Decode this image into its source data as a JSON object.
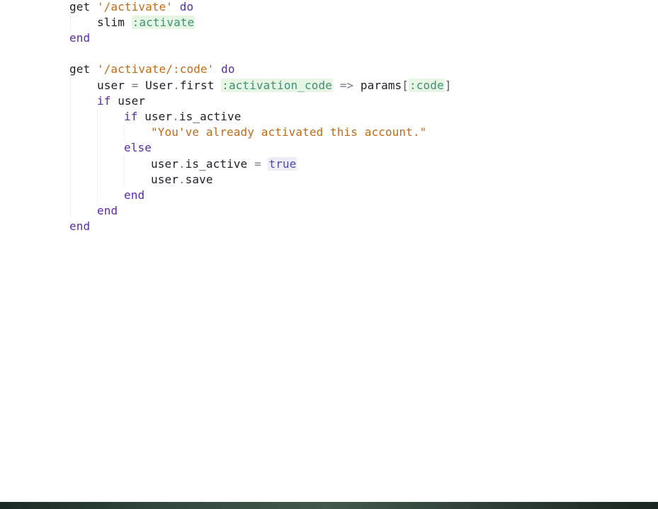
{
  "editor": {
    "lines": [
      [
        {
          "t": "get ",
          "c": "plain"
        },
        {
          "t": "'/activate'",
          "c": "str"
        },
        {
          "t": " ",
          "c": "plain"
        },
        {
          "t": "do",
          "c": "kw"
        }
      ],
      [
        {
          "t": "slim ",
          "c": "plain"
        },
        {
          "t": ":activate",
          "c": "sym"
        }
      ],
      [
        {
          "t": "end",
          "c": "kw"
        }
      ],
      [],
      [
        {
          "t": "get ",
          "c": "plain"
        },
        {
          "t": "'/activate/:code'",
          "c": "str"
        },
        {
          "t": " ",
          "c": "plain"
        },
        {
          "t": "do",
          "c": "kw"
        }
      ],
      [
        {
          "t": "user ",
          "c": "plain"
        },
        {
          "t": "=",
          "c": "punct"
        },
        {
          "t": " User",
          "c": "plain"
        },
        {
          "t": ".",
          "c": "punct"
        },
        {
          "t": "first ",
          "c": "plain"
        },
        {
          "t": ":activation_code",
          "c": "sym"
        },
        {
          "t": " ",
          "c": "plain"
        },
        {
          "t": "=>",
          "c": "punct"
        },
        {
          "t": " params",
          "c": "plain"
        },
        {
          "t": "[",
          "c": "brk"
        },
        {
          "t": ":code",
          "c": "sym"
        },
        {
          "t": "]",
          "c": "brk"
        }
      ],
      [
        {
          "t": "if",
          "c": "kw"
        },
        {
          "t": " user",
          "c": "plain"
        }
      ],
      [
        {
          "t": "if",
          "c": "kw"
        },
        {
          "t": " user",
          "c": "plain"
        },
        {
          "t": ".",
          "c": "punct"
        },
        {
          "t": "is_active",
          "c": "plain"
        }
      ],
      [
        {
          "t": "\"You've already activated this account.\"",
          "c": "str"
        }
      ],
      [
        {
          "t": "else",
          "c": "kw"
        }
      ],
      [
        {
          "t": "user",
          "c": "plain"
        },
        {
          "t": ".",
          "c": "punct"
        },
        {
          "t": "is_active ",
          "c": "plain"
        },
        {
          "t": "=",
          "c": "punct"
        },
        {
          "t": " ",
          "c": "plain"
        },
        {
          "t": "true",
          "c": "const"
        }
      ],
      [
        {
          "t": "user",
          "c": "plain"
        },
        {
          "t": ".",
          "c": "punct"
        },
        {
          "t": "save",
          "c": "plain"
        }
      ],
      [
        {
          "t": "end",
          "c": "kw"
        }
      ],
      [
        {
          "t": "end",
          "c": "kw"
        }
      ],
      [
        {
          "t": "end",
          "c": "kw"
        }
      ]
    ]
  },
  "colors": {
    "keyword": "#5b2bab",
    "string": "#c26a16",
    "symbol": "#3f8f7b",
    "symbol_bg": "#e7f6e2",
    "constant": "#4a4aa8",
    "text": "#1e1e2a",
    "taskbar": "#32483e"
  }
}
